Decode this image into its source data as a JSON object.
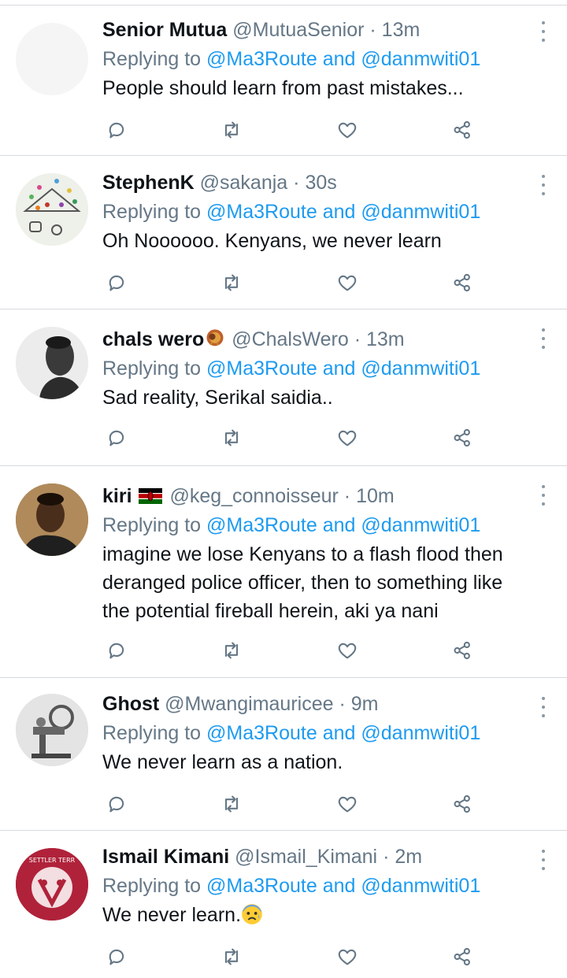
{
  "tweets": [
    {
      "name": "Senior Mutua",
      "handle": "@MutuaSenior",
      "time": "13m",
      "replying_prefix": "Replying to",
      "mention1": "@Ma3Route",
      "and": "and",
      "mention2": "@danmwiti01",
      "text": "People should learn from past mistakes..."
    },
    {
      "name": "StephenK",
      "handle": "@sakanja",
      "time": "30s",
      "replying_prefix": "Replying to",
      "mention1": "@Ma3Route",
      "and": "and",
      "mention2": "@danmwiti01",
      "text": "Oh Noooooo. Kenyans, we never learn"
    },
    {
      "name": "chals wero",
      "handle": "@ChalsWero",
      "time": "13m",
      "replying_prefix": "Replying to",
      "mention1": "@Ma3Route",
      "and": "and",
      "mention2": "@danmwiti01",
      "text": "Sad reality, Serikal saidia.."
    },
    {
      "name": "kiri",
      "handle": "@keg_connoisseur",
      "time": "10m",
      "replying_prefix": "Replying to",
      "mention1": "@Ma3Route",
      "and": "and",
      "mention2": "@danmwiti01",
      "line1": "imagine we lose Kenyans to a flash flood then",
      "line2": "deranged police officer, then to something like",
      "line3": "the potential fireball herein, aki ya nani"
    },
    {
      "name": "Ghost",
      "handle": "@Mwangimauricee",
      "time": "9m",
      "replying_prefix": "Replying to",
      "mention1": "@Ma3Route",
      "and": "and",
      "mention2": "@danmwiti01",
      "text": "We never learn as a nation."
    },
    {
      "name": "Ismail Kimani",
      "handle": "@Ismail_Kimani",
      "time": "2m",
      "replying_prefix": "Replying to",
      "mention1": "@Ma3Route",
      "and": "and",
      "mention2": "@danmwiti01",
      "text": "We never learn.",
      "avatar_text": "SETTLER TERR"
    }
  ],
  "separator": "·",
  "icons": {
    "reply": "reply-icon",
    "retweet": "retweet-icon",
    "like": "heart-icon",
    "share": "share-icon",
    "more": "more-icon"
  },
  "colors": {
    "link": "#1d9bf0",
    "muted": "#657786",
    "icon": "#657786",
    "text": "#0f1419"
  }
}
